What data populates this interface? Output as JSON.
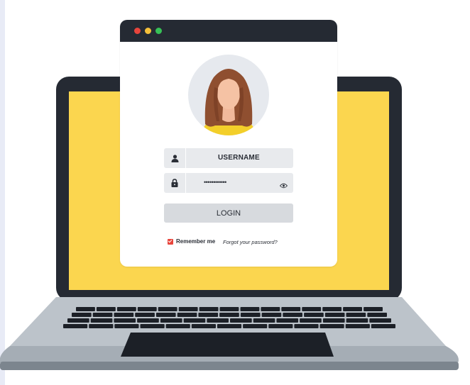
{
  "window": {
    "controls": [
      "close",
      "minimize",
      "maximize"
    ],
    "colors": {
      "close": "#e8453c",
      "minimize": "#f5c03a",
      "maximize": "#37c157",
      "titlebar": "#252a33"
    }
  },
  "login": {
    "username_label": "USERNAME",
    "password_value": "••••••••••••",
    "login_button": "LOGIN",
    "remember_me": "Remember me",
    "remember_checked": true,
    "forgot_password": "Forgot your password?"
  },
  "icons": [
    "user-icon",
    "lock-icon",
    "eye-icon",
    "avatar-woman"
  ],
  "colors": {
    "screen": "#fbd64f",
    "laptop_frame": "#252a33",
    "accent": "#e8453c"
  }
}
